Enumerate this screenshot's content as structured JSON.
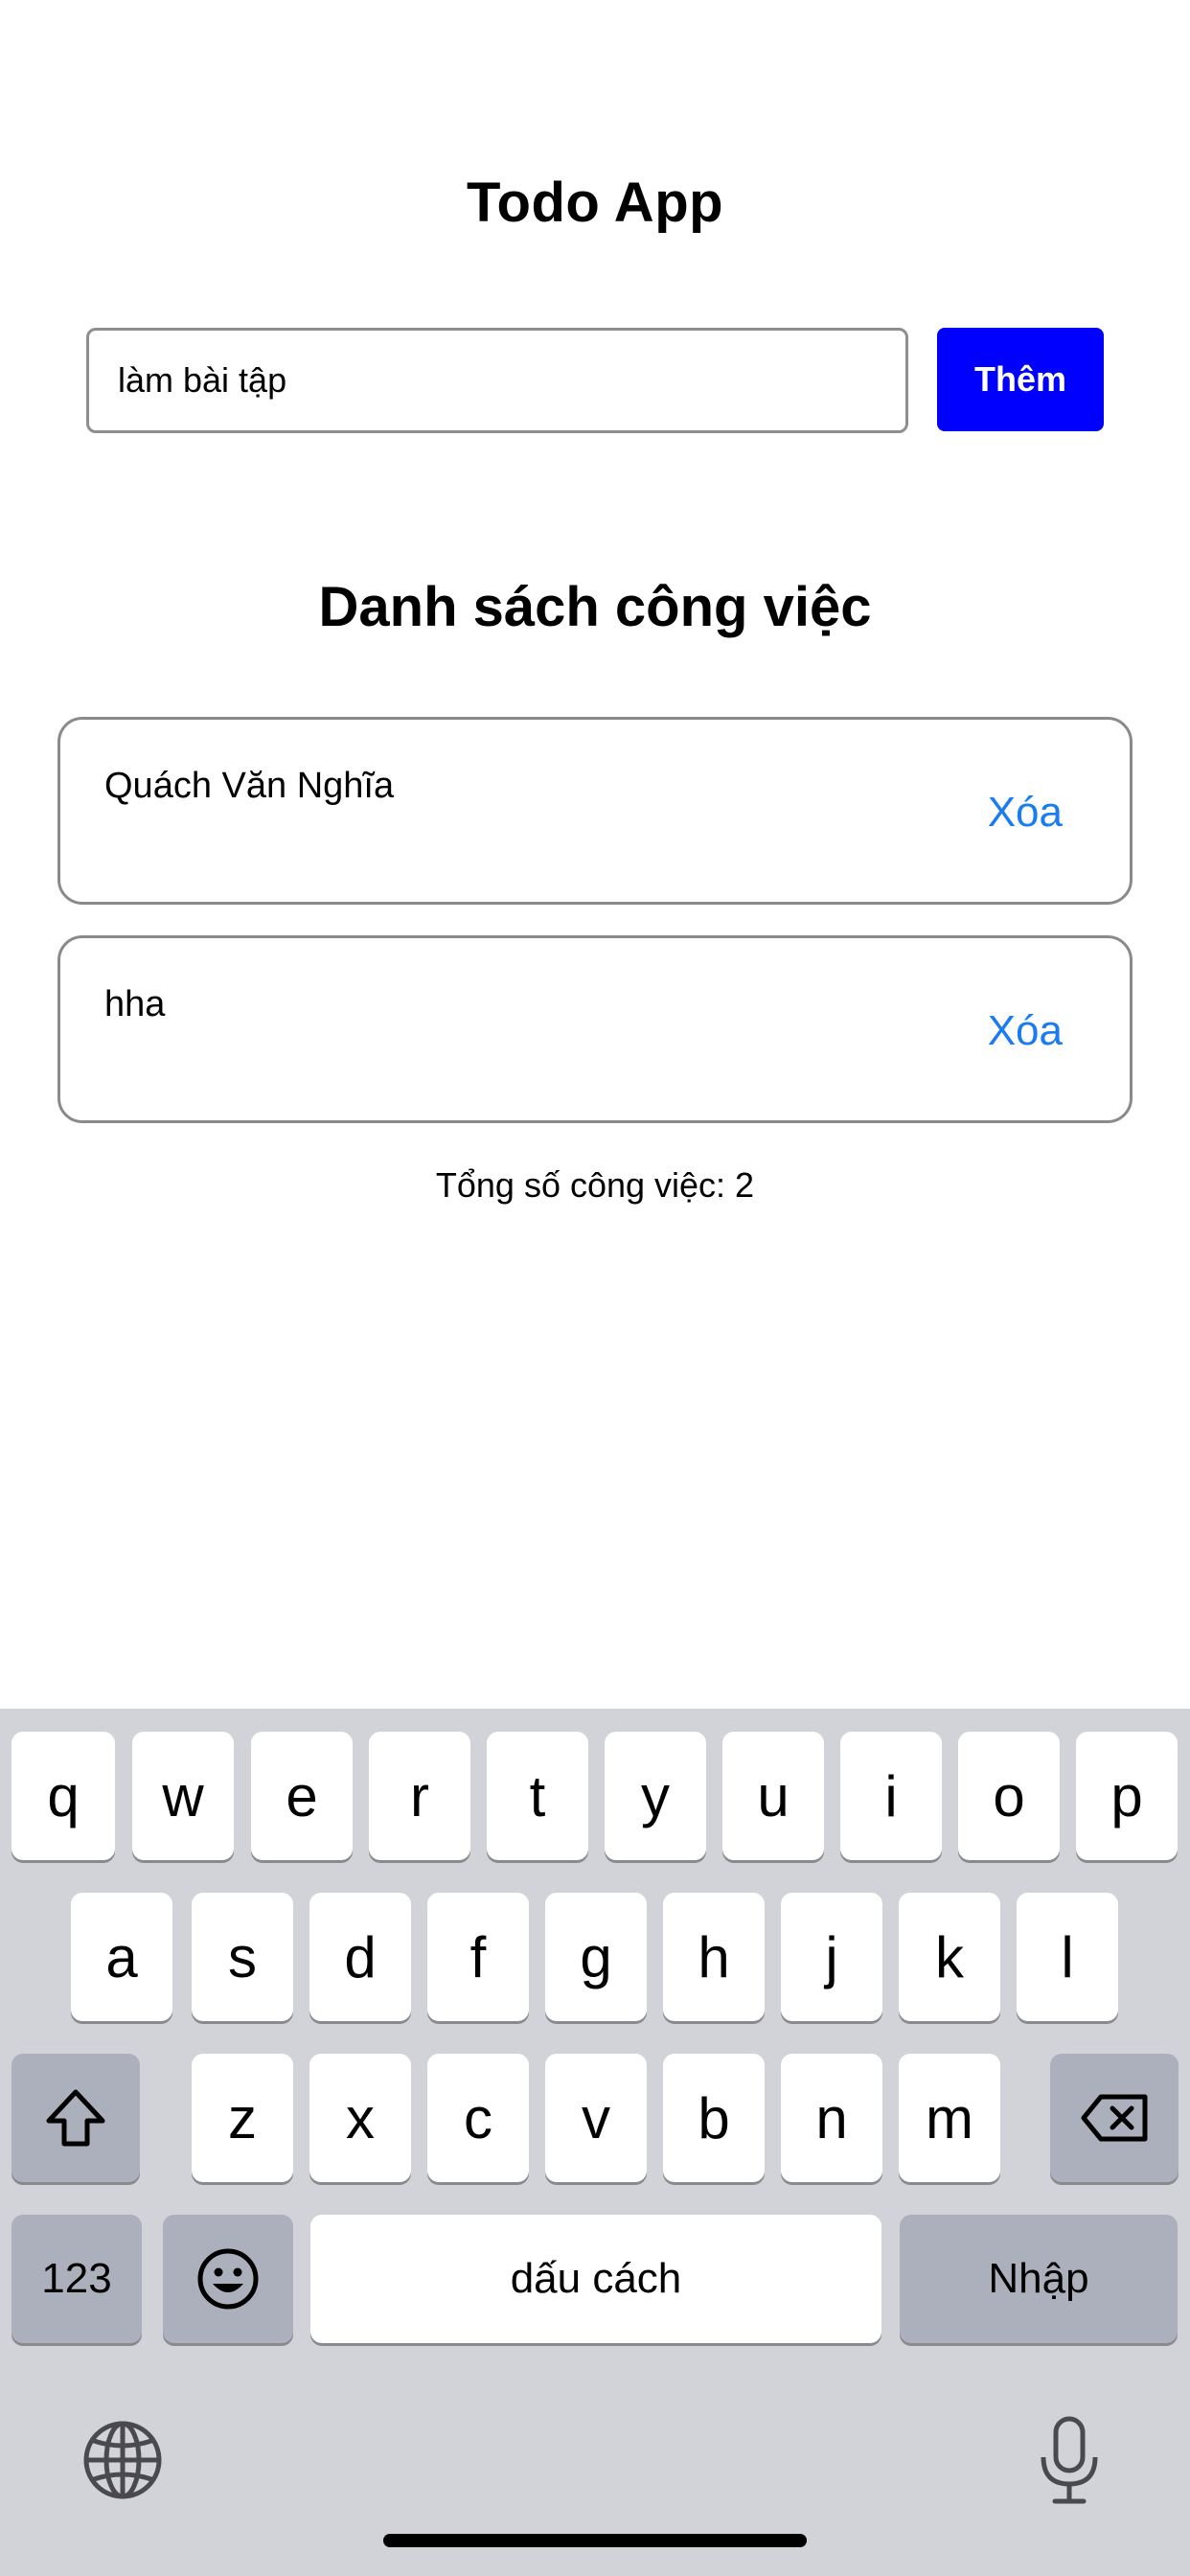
{
  "app": {
    "title": "Todo App"
  },
  "input": {
    "value": "làm bài tập"
  },
  "add_button": {
    "label": "Thêm",
    "color": "#0000ff"
  },
  "list": {
    "heading": "Danh sách công việc",
    "items": [
      {
        "text": "Quách Văn Nghĩa",
        "delete_label": "Xóa"
      },
      {
        "text": "hha",
        "delete_label": "Xóa"
      }
    ],
    "total_text": "Tổng số công việc: 2"
  },
  "keyboard": {
    "row1": [
      "q",
      "w",
      "e",
      "r",
      "t",
      "y",
      "u",
      "i",
      "o",
      "p"
    ],
    "row2": [
      "a",
      "s",
      "d",
      "f",
      "g",
      "h",
      "j",
      "k",
      "l"
    ],
    "row3": [
      "z",
      "x",
      "c",
      "v",
      "b",
      "n",
      "m"
    ],
    "numbers_label": "123",
    "space_label": "dấu cách",
    "return_label": "Nhập",
    "icons": [
      "shift-icon",
      "backspace-icon",
      "emoji-icon",
      "globe-icon",
      "microphone-icon"
    ]
  },
  "colors": {
    "accent_link": "#1a7cf0",
    "keyboard_bg": "#d1d3d9"
  }
}
